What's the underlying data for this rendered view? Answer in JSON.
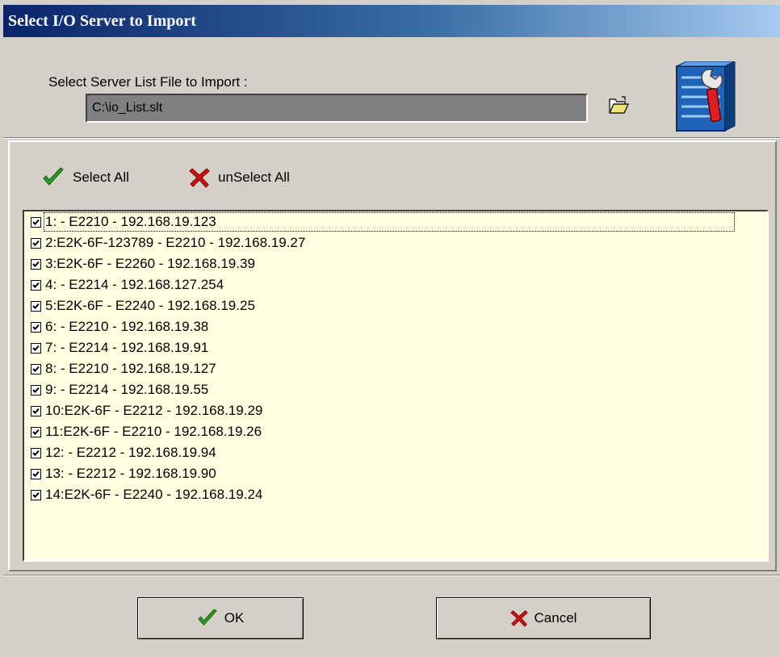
{
  "window": {
    "title": "Select I/O Server to Import"
  },
  "file": {
    "label": "Select Server List File to Import :",
    "path": "C:\\io_List.slt",
    "browse_icon": "folder-open-icon",
    "app_icon": "io-server-tools-icon"
  },
  "toolbar": {
    "select_all": "Select All",
    "unselect_all": "unSelect All"
  },
  "servers": [
    {
      "label": "1: - E2210 - 192.168.19.123",
      "checked": true
    },
    {
      "label": "2:E2K-6F-123789 - E2210 - 192.168.19.27",
      "checked": true
    },
    {
      "label": "3:E2K-6F - E2260 - 192.168.19.39",
      "checked": true
    },
    {
      "label": "4: - E2214 - 192.168.127.254",
      "checked": true
    },
    {
      "label": "5:E2K-6F - E2240 - 192.168.19.25",
      "checked": true
    },
    {
      "label": "6: - E2210 - 192.168.19.38",
      "checked": true
    },
    {
      "label": "7: - E2214 - 192.168.19.91",
      "checked": true
    },
    {
      "label": "8: - E2210 - 192.168.19.127",
      "checked": true
    },
    {
      "label": "9: - E2214 - 192.168.19.55",
      "checked": true
    },
    {
      "label": "10:E2K-6F - E2212 - 192.168.19.29",
      "checked": true
    },
    {
      "label": "11:E2K-6F - E2210 - 192.168.19.26",
      "checked": true
    },
    {
      "label": "12: - E2212 - 192.168.19.94",
      "checked": true
    },
    {
      "label": "13: - E2212 - 192.168.19.90",
      "checked": true
    },
    {
      "label": "14:E2K-6F - E2240 - 192.168.19.24",
      "checked": true
    }
  ],
  "buttons": {
    "ok": "OK",
    "cancel": "Cancel"
  },
  "colors": {
    "titlebar_start": "#0a246a",
    "titlebar_end": "#a6caf0",
    "list_background": "#ffffe1",
    "check_green": "#2e9a1e",
    "cross_red": "#d01010"
  }
}
